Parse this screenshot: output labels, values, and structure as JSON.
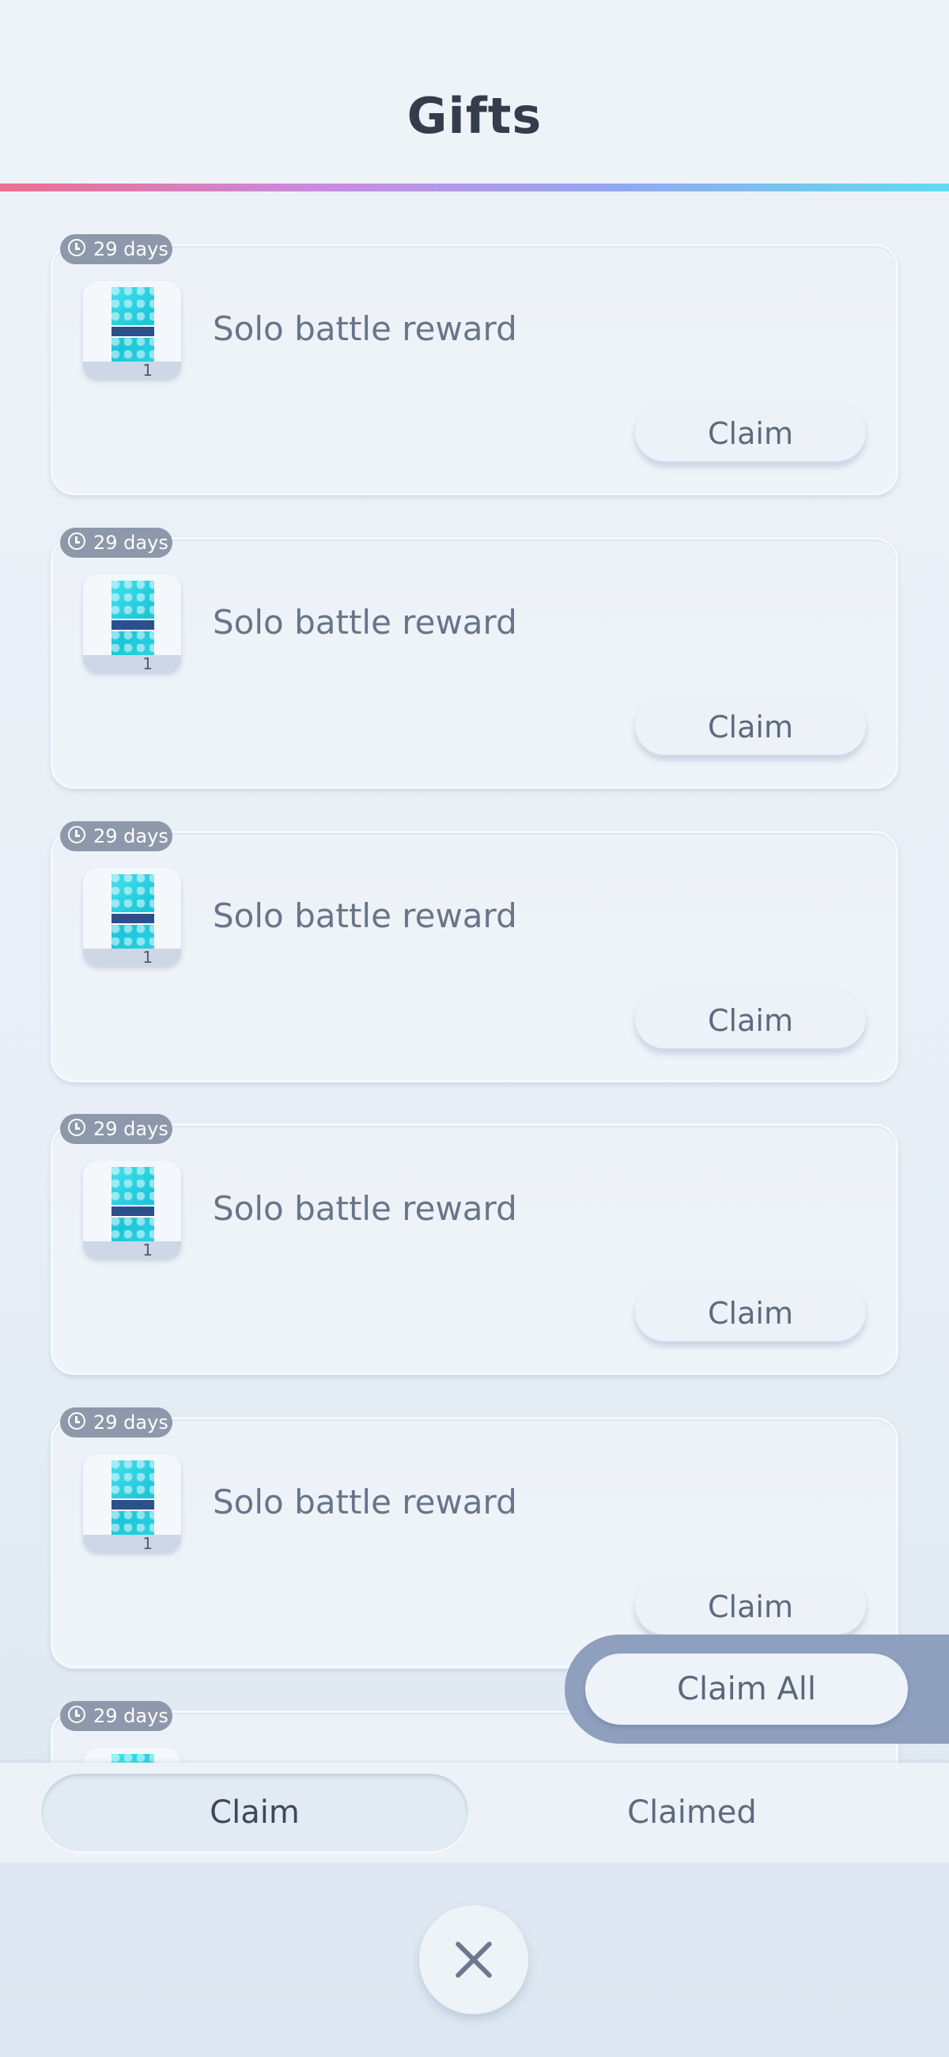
{
  "header": {
    "title": "Gifts"
  },
  "gifts": [
    {
      "expires": "29 days",
      "label": "Solo battle reward",
      "quantity": "1",
      "claim_label": "Claim"
    },
    {
      "expires": "29 days",
      "label": "Solo battle reward",
      "quantity": "1",
      "claim_label": "Claim"
    },
    {
      "expires": "29 days",
      "label": "Solo battle reward",
      "quantity": "1",
      "claim_label": "Claim"
    },
    {
      "expires": "29 days",
      "label": "Solo battle reward",
      "quantity": "1",
      "claim_label": "Claim"
    },
    {
      "expires": "29 days",
      "label": "Solo battle reward",
      "quantity": "1",
      "claim_label": "Claim"
    },
    {
      "expires": "29 days"
    }
  ],
  "claim_all_label": "Claim All",
  "tabs": [
    {
      "label": "Claim",
      "active": true
    },
    {
      "label": "Claimed",
      "active": false
    }
  ],
  "icons": {
    "timer": "clock-icon",
    "close": "close-icon"
  },
  "colors": {
    "accent_gradient": [
      "#ec6f8e",
      "#c98be3",
      "#92a8f2",
      "#5fdcf0"
    ],
    "badge": "#8d98ab",
    "claim_all_panel": "#8ea0bd",
    "title": "#343d4c"
  }
}
